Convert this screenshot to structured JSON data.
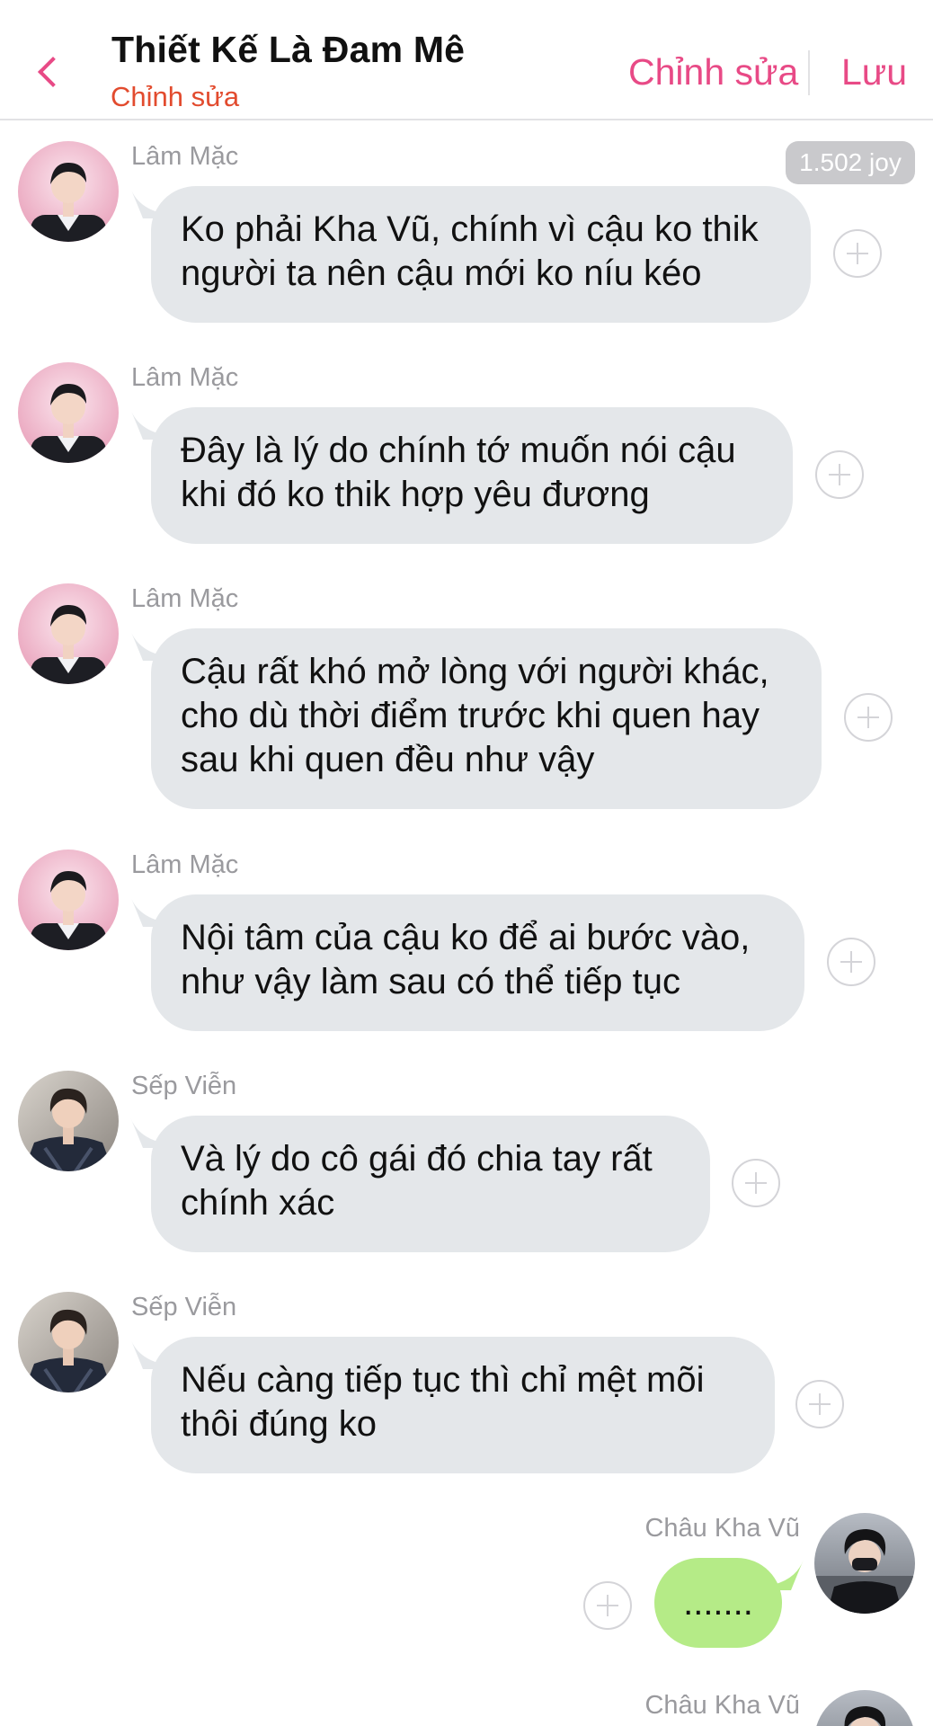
{
  "header": {
    "back_icon": "chevron-left-icon",
    "title": "Thiết Kế Là Đam Mê",
    "subtitle": "Chỉnh sửa",
    "edit_label": "Chỉnh sửa",
    "save_label": "Lưu",
    "accent_color": "#e84a86"
  },
  "badge": {
    "text": "1.502 joy"
  },
  "messages": [
    {
      "sender": "Lâm Mặc",
      "lines": [
        "Ko phải Kha Vũ, chính vì cậu ko thik",
        "người ta nên cậu mới ko níu kéo"
      ],
      "side": "left",
      "avatar": "avatar-lam-mac"
    },
    {
      "sender": "Lâm Mặc",
      "lines": [
        "Đây là lý do chính tớ muốn nói cậu",
        "khi đó ko thik hợp yêu đương"
      ],
      "side": "left",
      "avatar": "avatar-lam-mac"
    },
    {
      "sender": "Lâm Mặc",
      "lines": [
        "Cậu rất khó mở lòng với người khác,",
        "cho dù thời điểm trước khi quen hay",
        "sau khi quen đều như vậy"
      ],
      "side": "left",
      "avatar": "avatar-lam-mac"
    },
    {
      "sender": "Lâm Mặc",
      "lines": [
        "Nội tâm của cậu ko để ai bước vào,",
        "như vậy làm sau có thể tiếp tục"
      ],
      "side": "left",
      "avatar": "avatar-lam-mac"
    },
    {
      "sender": "Sếp Viễn",
      "lines": [
        "Và lý do cô gái đó chia tay rất",
        "chính xác"
      ],
      "side": "left",
      "avatar": "avatar-sep-vien"
    },
    {
      "sender": "Sếp Viễn",
      "lines": [
        "Nếu càng tiếp tục thì chỉ mệt mõi",
        "thôi đúng ko"
      ],
      "side": "left",
      "avatar": "avatar-sep-vien"
    },
    {
      "sender": "Châu Kha Vũ",
      "lines": [
        "......."
      ],
      "side": "right",
      "avatar": "avatar-chau-kha-vu"
    },
    {
      "sender": "Châu Kha Vũ",
      "lines": [],
      "side": "right",
      "avatar": "avatar-chau-kha-vu"
    }
  ],
  "colors": {
    "incoming_bubble": "#e4e7ea",
    "outgoing_bubble": "#b5eb87",
    "sender_name": "#9a9a9e",
    "subtitle": "#e24b2e"
  }
}
